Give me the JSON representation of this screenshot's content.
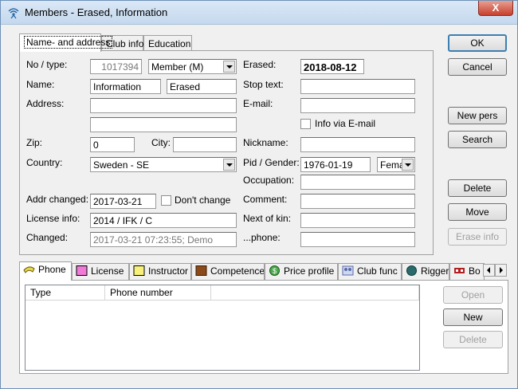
{
  "window": {
    "title": "Members - Erased, Information",
    "close_glyph": "X"
  },
  "top_tabs": [
    "Name- and address",
    "Club info",
    "Education"
  ],
  "form": {
    "no_type_label": "No / type:",
    "member_no": "1017394",
    "member_type": "Member  (M)",
    "name_label": "Name:",
    "first_name": "Information",
    "last_name": "Erased",
    "address_label": "Address:",
    "address1": "",
    "address2": "",
    "zip_label": "Zip:",
    "zip": "0",
    "city_label": "City:",
    "city": "",
    "country_label": "Country:",
    "country": "Sweden - SE",
    "addr_changed_label": "Addr changed:",
    "addr_changed": "2017-03-21",
    "dont_change_label": "Don't change",
    "dont_change_checked": false,
    "license_label": "License info:",
    "license": "2014 / IFK / C",
    "changed_label": "Changed:",
    "changed": "2017-03-21 07:23:55; Demo",
    "erased_label": "Erased:",
    "erased": "2018-08-12",
    "stop_text_label": "Stop text:",
    "stop_text": "",
    "email_label": "E-mail:",
    "email": "",
    "info_email_label": "Info via E-mail",
    "info_email_checked": false,
    "nickname_label": "Nickname:",
    "nickname": "",
    "pid_gender_label": "Pid / Gender:",
    "pid": "1976-01-19",
    "gender": "Fema",
    "occupation_label": "Occupation:",
    "occupation": "",
    "comment_label": "Comment:",
    "comment": "",
    "next_of_kin_label": "Next of kin:",
    "next_of_kin": "",
    "phone_label": "...phone:",
    "phone": ""
  },
  "buttons": {
    "ok": "OK",
    "cancel": "Cancel",
    "new_pers": "New pers",
    "search": "Search",
    "delete": "Delete",
    "move": "Move",
    "erase_info": "Erase info",
    "open": "Open",
    "new": "New",
    "delete_phone": "Delete"
  },
  "bottom_tabs": [
    {
      "label": "Phone",
      "icon": "phone-icon",
      "color": "#e8d84a"
    },
    {
      "label": "License",
      "icon": "license-icon",
      "color": "#f07ad8"
    },
    {
      "label": "Instructor",
      "icon": "instructor-icon",
      "color": "#f7f07a"
    },
    {
      "label": "Competence",
      "icon": "competence-icon",
      "color": "#8a4a1a"
    },
    {
      "label": "Price profile",
      "icon": "price-icon",
      "color": "#4aa84a"
    },
    {
      "label": "Club func",
      "icon": "club-func-icon",
      "color": "#5a6aa8"
    },
    {
      "label": "Rigger",
      "icon": "rigger-icon",
      "color": "#2a6a6a"
    },
    {
      "label": "Bo",
      "icon": "bo-icon",
      "color": "#b02020"
    }
  ],
  "phone_list": {
    "columns": [
      "Type",
      "Phone number"
    ],
    "rows": []
  }
}
